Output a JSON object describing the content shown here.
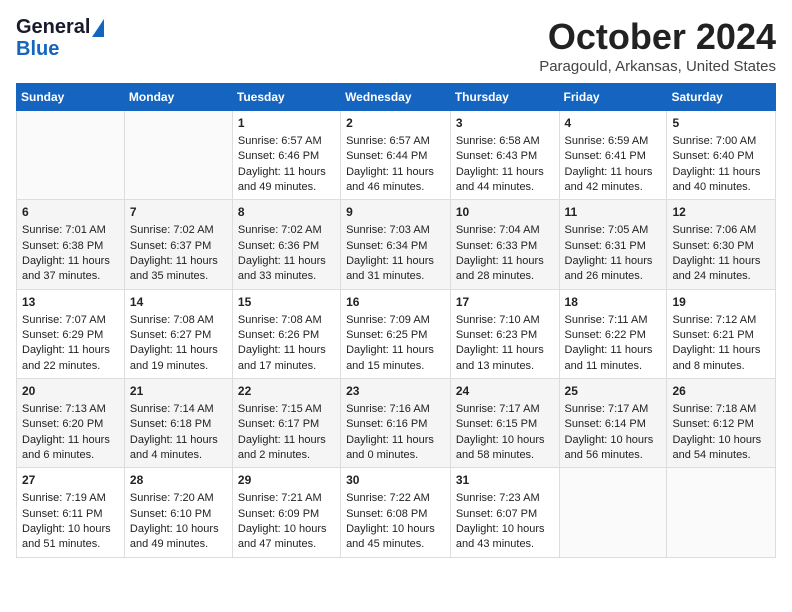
{
  "header": {
    "logo_line1": "General",
    "logo_line2": "Blue",
    "month": "October 2024",
    "location": "Paragould, Arkansas, United States"
  },
  "days_of_week": [
    "Sunday",
    "Monday",
    "Tuesday",
    "Wednesday",
    "Thursday",
    "Friday",
    "Saturday"
  ],
  "weeks": [
    [
      {
        "day": "",
        "info": ""
      },
      {
        "day": "",
        "info": ""
      },
      {
        "day": "1",
        "info": "Sunrise: 6:57 AM\nSunset: 6:46 PM\nDaylight: 11 hours and 49 minutes."
      },
      {
        "day": "2",
        "info": "Sunrise: 6:57 AM\nSunset: 6:44 PM\nDaylight: 11 hours and 46 minutes."
      },
      {
        "day": "3",
        "info": "Sunrise: 6:58 AM\nSunset: 6:43 PM\nDaylight: 11 hours and 44 minutes."
      },
      {
        "day": "4",
        "info": "Sunrise: 6:59 AM\nSunset: 6:41 PM\nDaylight: 11 hours and 42 minutes."
      },
      {
        "day": "5",
        "info": "Sunrise: 7:00 AM\nSunset: 6:40 PM\nDaylight: 11 hours and 40 minutes."
      }
    ],
    [
      {
        "day": "6",
        "info": "Sunrise: 7:01 AM\nSunset: 6:38 PM\nDaylight: 11 hours and 37 minutes."
      },
      {
        "day": "7",
        "info": "Sunrise: 7:02 AM\nSunset: 6:37 PM\nDaylight: 11 hours and 35 minutes."
      },
      {
        "day": "8",
        "info": "Sunrise: 7:02 AM\nSunset: 6:36 PM\nDaylight: 11 hours and 33 minutes."
      },
      {
        "day": "9",
        "info": "Sunrise: 7:03 AM\nSunset: 6:34 PM\nDaylight: 11 hours and 31 minutes."
      },
      {
        "day": "10",
        "info": "Sunrise: 7:04 AM\nSunset: 6:33 PM\nDaylight: 11 hours and 28 minutes."
      },
      {
        "day": "11",
        "info": "Sunrise: 7:05 AM\nSunset: 6:31 PM\nDaylight: 11 hours and 26 minutes."
      },
      {
        "day": "12",
        "info": "Sunrise: 7:06 AM\nSunset: 6:30 PM\nDaylight: 11 hours and 24 minutes."
      }
    ],
    [
      {
        "day": "13",
        "info": "Sunrise: 7:07 AM\nSunset: 6:29 PM\nDaylight: 11 hours and 22 minutes."
      },
      {
        "day": "14",
        "info": "Sunrise: 7:08 AM\nSunset: 6:27 PM\nDaylight: 11 hours and 19 minutes."
      },
      {
        "day": "15",
        "info": "Sunrise: 7:08 AM\nSunset: 6:26 PM\nDaylight: 11 hours and 17 minutes."
      },
      {
        "day": "16",
        "info": "Sunrise: 7:09 AM\nSunset: 6:25 PM\nDaylight: 11 hours and 15 minutes."
      },
      {
        "day": "17",
        "info": "Sunrise: 7:10 AM\nSunset: 6:23 PM\nDaylight: 11 hours and 13 minutes."
      },
      {
        "day": "18",
        "info": "Sunrise: 7:11 AM\nSunset: 6:22 PM\nDaylight: 11 hours and 11 minutes."
      },
      {
        "day": "19",
        "info": "Sunrise: 7:12 AM\nSunset: 6:21 PM\nDaylight: 11 hours and 8 minutes."
      }
    ],
    [
      {
        "day": "20",
        "info": "Sunrise: 7:13 AM\nSunset: 6:20 PM\nDaylight: 11 hours and 6 minutes."
      },
      {
        "day": "21",
        "info": "Sunrise: 7:14 AM\nSunset: 6:18 PM\nDaylight: 11 hours and 4 minutes."
      },
      {
        "day": "22",
        "info": "Sunrise: 7:15 AM\nSunset: 6:17 PM\nDaylight: 11 hours and 2 minutes."
      },
      {
        "day": "23",
        "info": "Sunrise: 7:16 AM\nSunset: 6:16 PM\nDaylight: 11 hours and 0 minutes."
      },
      {
        "day": "24",
        "info": "Sunrise: 7:17 AM\nSunset: 6:15 PM\nDaylight: 10 hours and 58 minutes."
      },
      {
        "day": "25",
        "info": "Sunrise: 7:17 AM\nSunset: 6:14 PM\nDaylight: 10 hours and 56 minutes."
      },
      {
        "day": "26",
        "info": "Sunrise: 7:18 AM\nSunset: 6:12 PM\nDaylight: 10 hours and 54 minutes."
      }
    ],
    [
      {
        "day": "27",
        "info": "Sunrise: 7:19 AM\nSunset: 6:11 PM\nDaylight: 10 hours and 51 minutes."
      },
      {
        "day": "28",
        "info": "Sunrise: 7:20 AM\nSunset: 6:10 PM\nDaylight: 10 hours and 49 minutes."
      },
      {
        "day": "29",
        "info": "Sunrise: 7:21 AM\nSunset: 6:09 PM\nDaylight: 10 hours and 47 minutes."
      },
      {
        "day": "30",
        "info": "Sunrise: 7:22 AM\nSunset: 6:08 PM\nDaylight: 10 hours and 45 minutes."
      },
      {
        "day": "31",
        "info": "Sunrise: 7:23 AM\nSunset: 6:07 PM\nDaylight: 10 hours and 43 minutes."
      },
      {
        "day": "",
        "info": ""
      },
      {
        "day": "",
        "info": ""
      }
    ]
  ]
}
